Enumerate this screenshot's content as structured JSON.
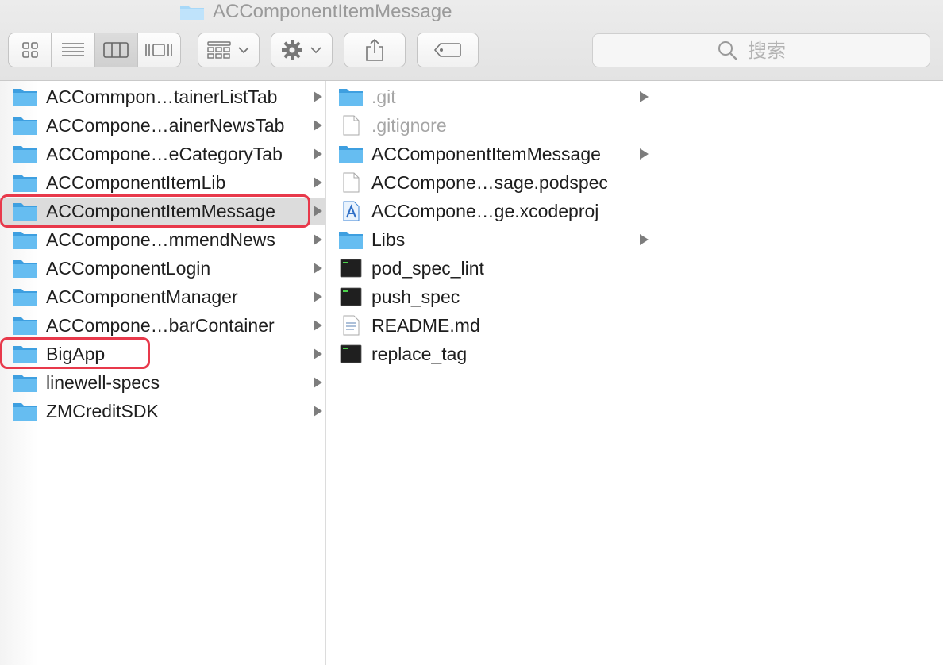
{
  "window": {
    "title": "ACComponentItemMessage"
  },
  "toolbar": {
    "view_modes": [
      "icon-view",
      "list-view",
      "column-view",
      "cover-flow-view"
    ],
    "active_view": "column-view",
    "search": {
      "placeholder": "搜索"
    }
  },
  "columns": {
    "first": [
      {
        "label": "ACCommpon…tainerListTab",
        "type": "folder",
        "has_children": true
      },
      {
        "label": "ACCompone…ainerNewsTab",
        "type": "folder",
        "has_children": true
      },
      {
        "label": "ACCompone…eCategoryTab",
        "type": "folder",
        "has_children": true
      },
      {
        "label": "ACComponentItemLib",
        "type": "folder",
        "has_children": true
      },
      {
        "label": "ACComponentItemMessage",
        "type": "folder",
        "has_children": true,
        "selected": true
      },
      {
        "label": "ACCompone…mmendNews",
        "type": "folder",
        "has_children": true
      },
      {
        "label": "ACComponentLogin",
        "type": "folder",
        "has_children": true
      },
      {
        "label": "ACComponentManager",
        "type": "folder",
        "has_children": true
      },
      {
        "label": "ACCompone…barContainer",
        "type": "folder",
        "has_children": true
      },
      {
        "label": "BigApp",
        "type": "folder",
        "has_children": true
      },
      {
        "label": "linewell-specs",
        "type": "folder",
        "has_children": true
      },
      {
        "label": "ZMCreditSDK",
        "type": "folder",
        "has_children": true
      }
    ],
    "second": [
      {
        "label": ".git",
        "type": "folder",
        "has_children": true,
        "hidden": true
      },
      {
        "label": ".gitignore",
        "type": "document",
        "has_children": false,
        "hidden": true
      },
      {
        "label": "ACComponentItemMessage",
        "type": "folder",
        "has_children": true
      },
      {
        "label": "ACCompone…sage.podspec",
        "type": "document",
        "has_children": false
      },
      {
        "label": "ACCompone…ge.xcodeproj",
        "type": "xcodeproj",
        "has_children": false
      },
      {
        "label": "Libs",
        "type": "folder",
        "has_children": true
      },
      {
        "label": "pod_spec_lint",
        "type": "terminal",
        "has_children": false
      },
      {
        "label": "push_spec",
        "type": "terminal",
        "has_children": false
      },
      {
        "label": "README.md",
        "type": "text-document",
        "has_children": false
      },
      {
        "label": "replace_tag",
        "type": "terminal",
        "has_children": false
      }
    ]
  },
  "colors": {
    "folder_blue": "#5db4ec",
    "selection_gray": "#dcdcdc",
    "annotation_red": "#e8394b"
  }
}
